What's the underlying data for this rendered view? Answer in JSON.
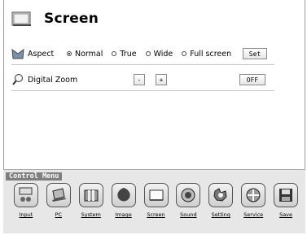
{
  "page": {
    "title": "Screen"
  },
  "aspect": {
    "label": "Aspect",
    "options": [
      "Normal",
      "True",
      "Wide",
      "Full screen"
    ],
    "selected": "Normal",
    "set_label": "Set"
  },
  "digital_zoom": {
    "label": "Digital Zoom",
    "minus_label": "-",
    "plus_label": "+",
    "state_label": "OFF"
  },
  "control_menu": {
    "title": "Control Menu",
    "items": [
      {
        "label": "Input",
        "icon": "input-icon"
      },
      {
        "label": "PC",
        "icon": "pc-icon"
      },
      {
        "label": "System",
        "icon": "system-icon"
      },
      {
        "label": "Image",
        "icon": "image-icon"
      },
      {
        "label": "Screen",
        "icon": "screen-icon"
      },
      {
        "label": "Sound",
        "icon": "sound-icon"
      },
      {
        "label": "Setting",
        "icon": "setting-icon"
      },
      {
        "label": "Service",
        "icon": "service-icon"
      },
      {
        "label": "Save",
        "icon": "save-icon"
      }
    ]
  }
}
